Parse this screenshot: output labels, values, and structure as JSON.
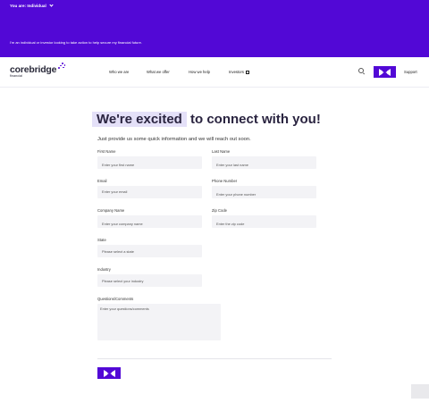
{
  "audience": {
    "selector_label": "You are: Individual",
    "tagline": "I'm an individual or investor looking to take action to help secure my financial future."
  },
  "brand": {
    "name": "corebridge",
    "sub": "financial",
    "accent": "#5208d6"
  },
  "nav": {
    "items": [
      "Who we are",
      "What we offer",
      "How we help",
      "Investors"
    ],
    "support": "Support"
  },
  "form": {
    "headline_highlight": "We're excited",
    "headline_rest": "to connect with you!",
    "subhead": "Just provide us some quick information and we will reach out soon.",
    "fields": [
      {
        "label": "First Name",
        "placeholder": "Enter your first name"
      },
      {
        "label": "Last Name",
        "placeholder": "Enter your last name"
      },
      {
        "label": "Email",
        "placeholder": "Enter your email"
      },
      {
        "label": "Phone Number",
        "placeholder": "Enter your phone number"
      },
      {
        "label": "Company Name",
        "placeholder": "Enter your company name"
      },
      {
        "label": "Zip Code",
        "placeholder": "Enter the zip code"
      },
      {
        "label": "State",
        "placeholder": "Please select a state"
      },
      {
        "label": "Industry",
        "placeholder": "Please select your industry"
      },
      {
        "label": "Questions/Comments",
        "placeholder": "Enter your questions/comments"
      }
    ]
  }
}
